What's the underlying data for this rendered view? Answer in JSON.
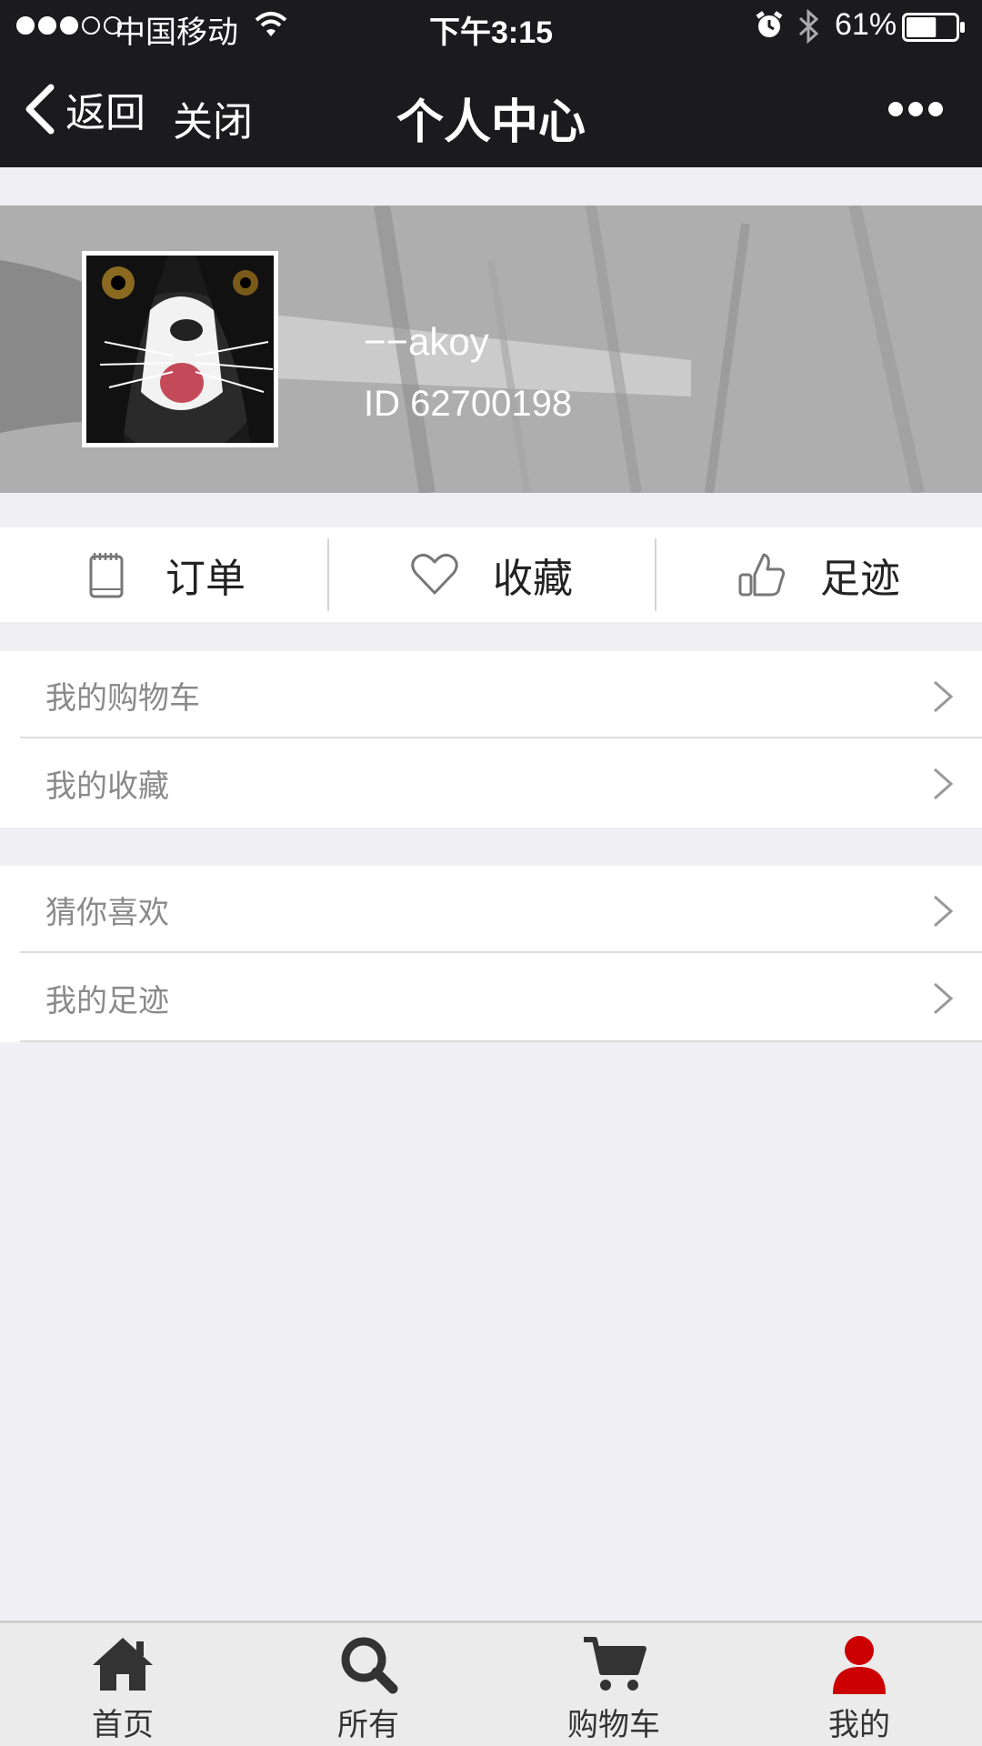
{
  "status_bar": {
    "carrier": "中国移动",
    "time": "下午3:15",
    "battery_percent": "61%",
    "signal_strength": 3,
    "signal_max": 5,
    "battery_level": 0.61
  },
  "nav": {
    "back_label": "返回",
    "close_label": "关闭",
    "title": "个人中心"
  },
  "profile": {
    "username": "−−akoy",
    "user_id": "ID 62700198"
  },
  "quick_actions": [
    {
      "label": "订单",
      "icon": "notepad-icon"
    },
    {
      "label": "收藏",
      "icon": "heart-icon"
    },
    {
      "label": "足迹",
      "icon": "thumbs-up-icon"
    }
  ],
  "list_group_1": [
    {
      "label": "我的购物车"
    },
    {
      "label": "我的收藏"
    }
  ],
  "list_group_2": [
    {
      "label": "猜你喜欢"
    },
    {
      "label": "我的足迹"
    }
  ],
  "tabs": [
    {
      "label": "首页",
      "icon": "home-icon"
    },
    {
      "label": "所有",
      "icon": "search-icon"
    },
    {
      "label": "购物车",
      "icon": "cart-icon"
    },
    {
      "label": "我的",
      "icon": "user-icon",
      "active": true
    }
  ],
  "colors": {
    "bar_bg": "#1b1b1d",
    "page_bg": "#efeff4",
    "active_tab": "#cc0000",
    "inactive_tab": "#333333"
  }
}
